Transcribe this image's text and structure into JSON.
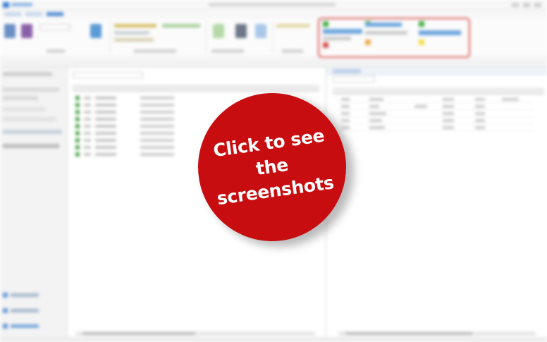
{
  "overlay": {
    "line1": "Click to see the",
    "line2": "screenshots",
    "background": "#c80d10",
    "text_color": "#ffffff"
  },
  "app": {
    "accent": "#3b7fd1",
    "highlight_color": "#d9534f",
    "status_green": "#52a852",
    "grid_row_count": 9,
    "detail_row_count": 5
  }
}
